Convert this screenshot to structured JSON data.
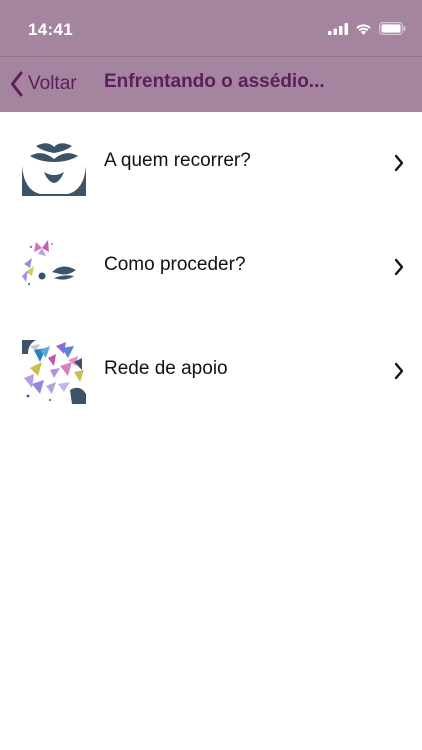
{
  "status_bar": {
    "time": "14:41",
    "icons": [
      "signal-icon",
      "wifi-icon",
      "battery-icon"
    ]
  },
  "nav": {
    "back_label": "Voltar",
    "title": "Enfrentando o assédio...",
    "back_icon": "chevron-left-icon"
  },
  "list": {
    "items": [
      {
        "label": "A quem recorrer?",
        "thumbnail": "face-lips-illustration"
      },
      {
        "label": "Como proceder?",
        "thumbnail": "butterflies-eye-illustration"
      },
      {
        "label": "Rede de apoio",
        "thumbnail": "colorful-butterflies-illustration"
      }
    ],
    "chevron_icon": "chevron-right-icon"
  },
  "colors": {
    "header_bg": "#a4849e",
    "nav_text": "#5b1f5c",
    "item_text": "#111111",
    "thumbnail_dark": "#3d5468"
  }
}
